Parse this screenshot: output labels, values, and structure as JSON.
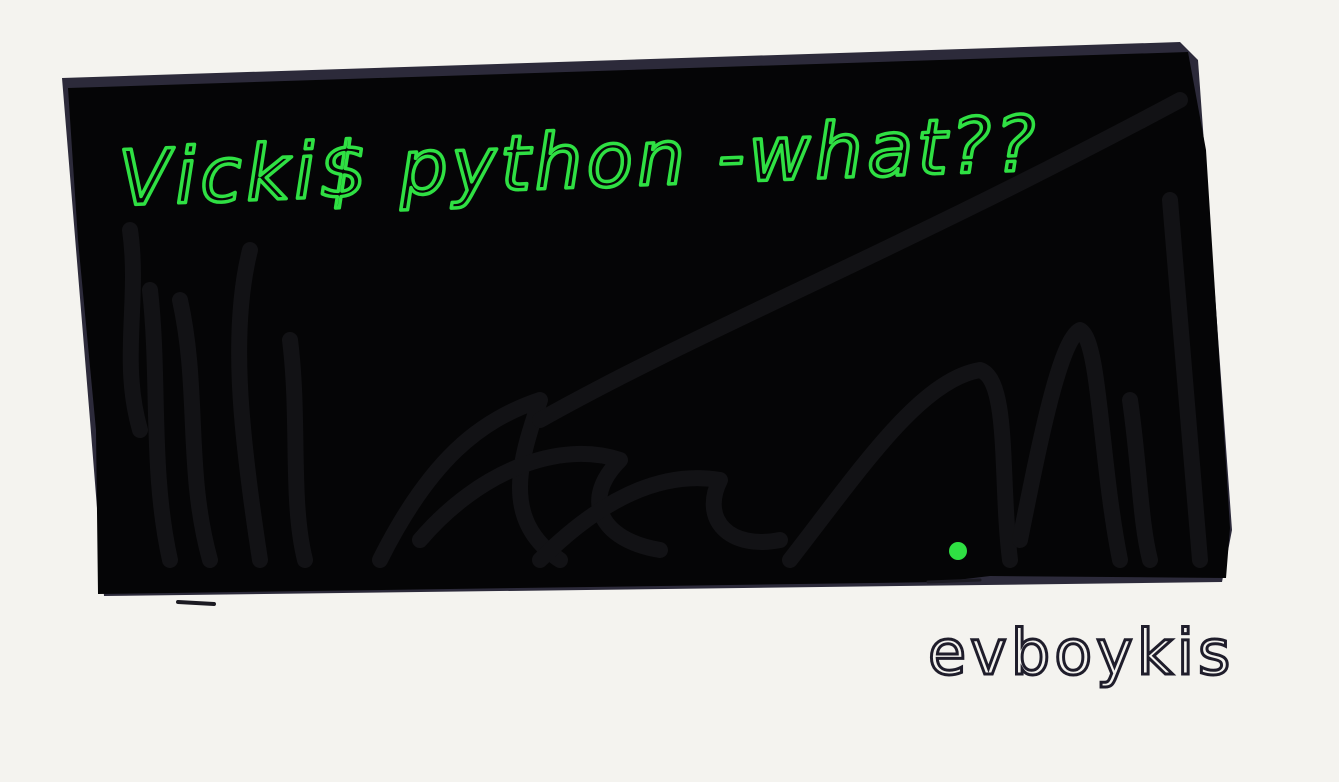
{
  "terminal": {
    "command_line": "Vicki$  python -what??",
    "text_color": "#2fe043",
    "background_color": "#0b0b0d",
    "cursor_color": "#2fe043"
  },
  "signature": {
    "text": "evboykis",
    "color": "#1f1d2b"
  },
  "page": {
    "background_color": "#f4f3ef"
  }
}
